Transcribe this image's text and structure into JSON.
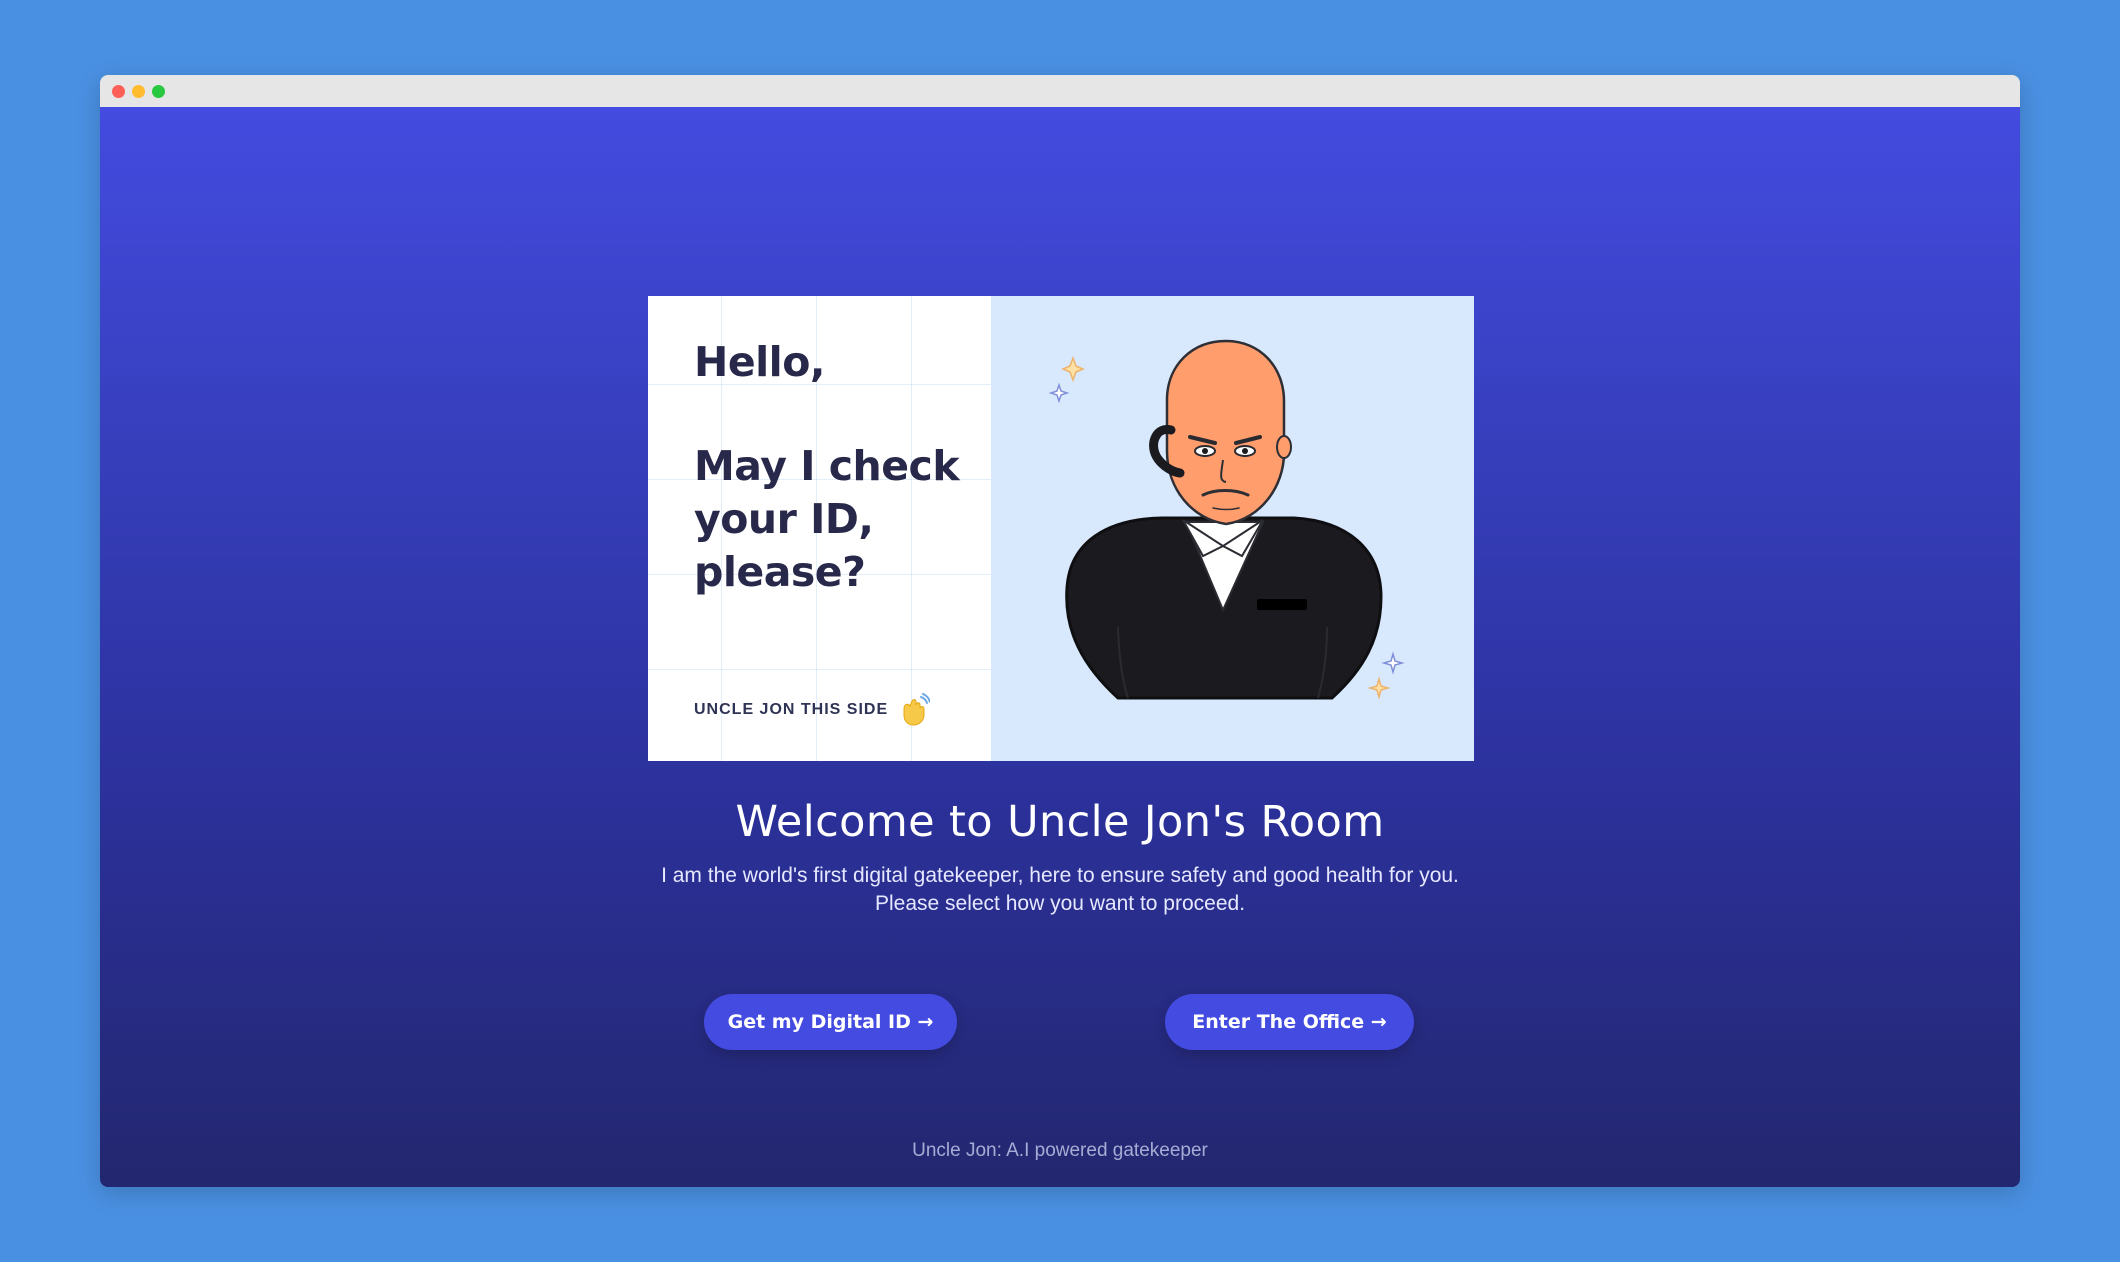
{
  "page": {
    "background_color": "#4a90e2"
  },
  "window": {
    "controls": [
      "close",
      "minimize",
      "maximize"
    ]
  },
  "hero": {
    "greeting": "Hello,",
    "question": "May I check your ID, please?",
    "tagline": "UNCLE JON THIS SIDE",
    "wave_icon": "waving-hand-icon",
    "illustration": "security-guard-illustration",
    "illustration_background": "#d8e8fd"
  },
  "main": {
    "title": "Welcome to Uncle Jon's Room",
    "subtitle_line1": "I am the world's first digital gatekeeper, here to ensure safety and good health for you.",
    "subtitle_line2": "Please select how you want to proceed."
  },
  "actions": {
    "digital_id_label": "Get my Digital ID →",
    "office_label": "Enter The Office →",
    "button_color": "#434be0"
  },
  "footer": {
    "text": "Uncle Jon: A.I powered gatekeeper"
  }
}
